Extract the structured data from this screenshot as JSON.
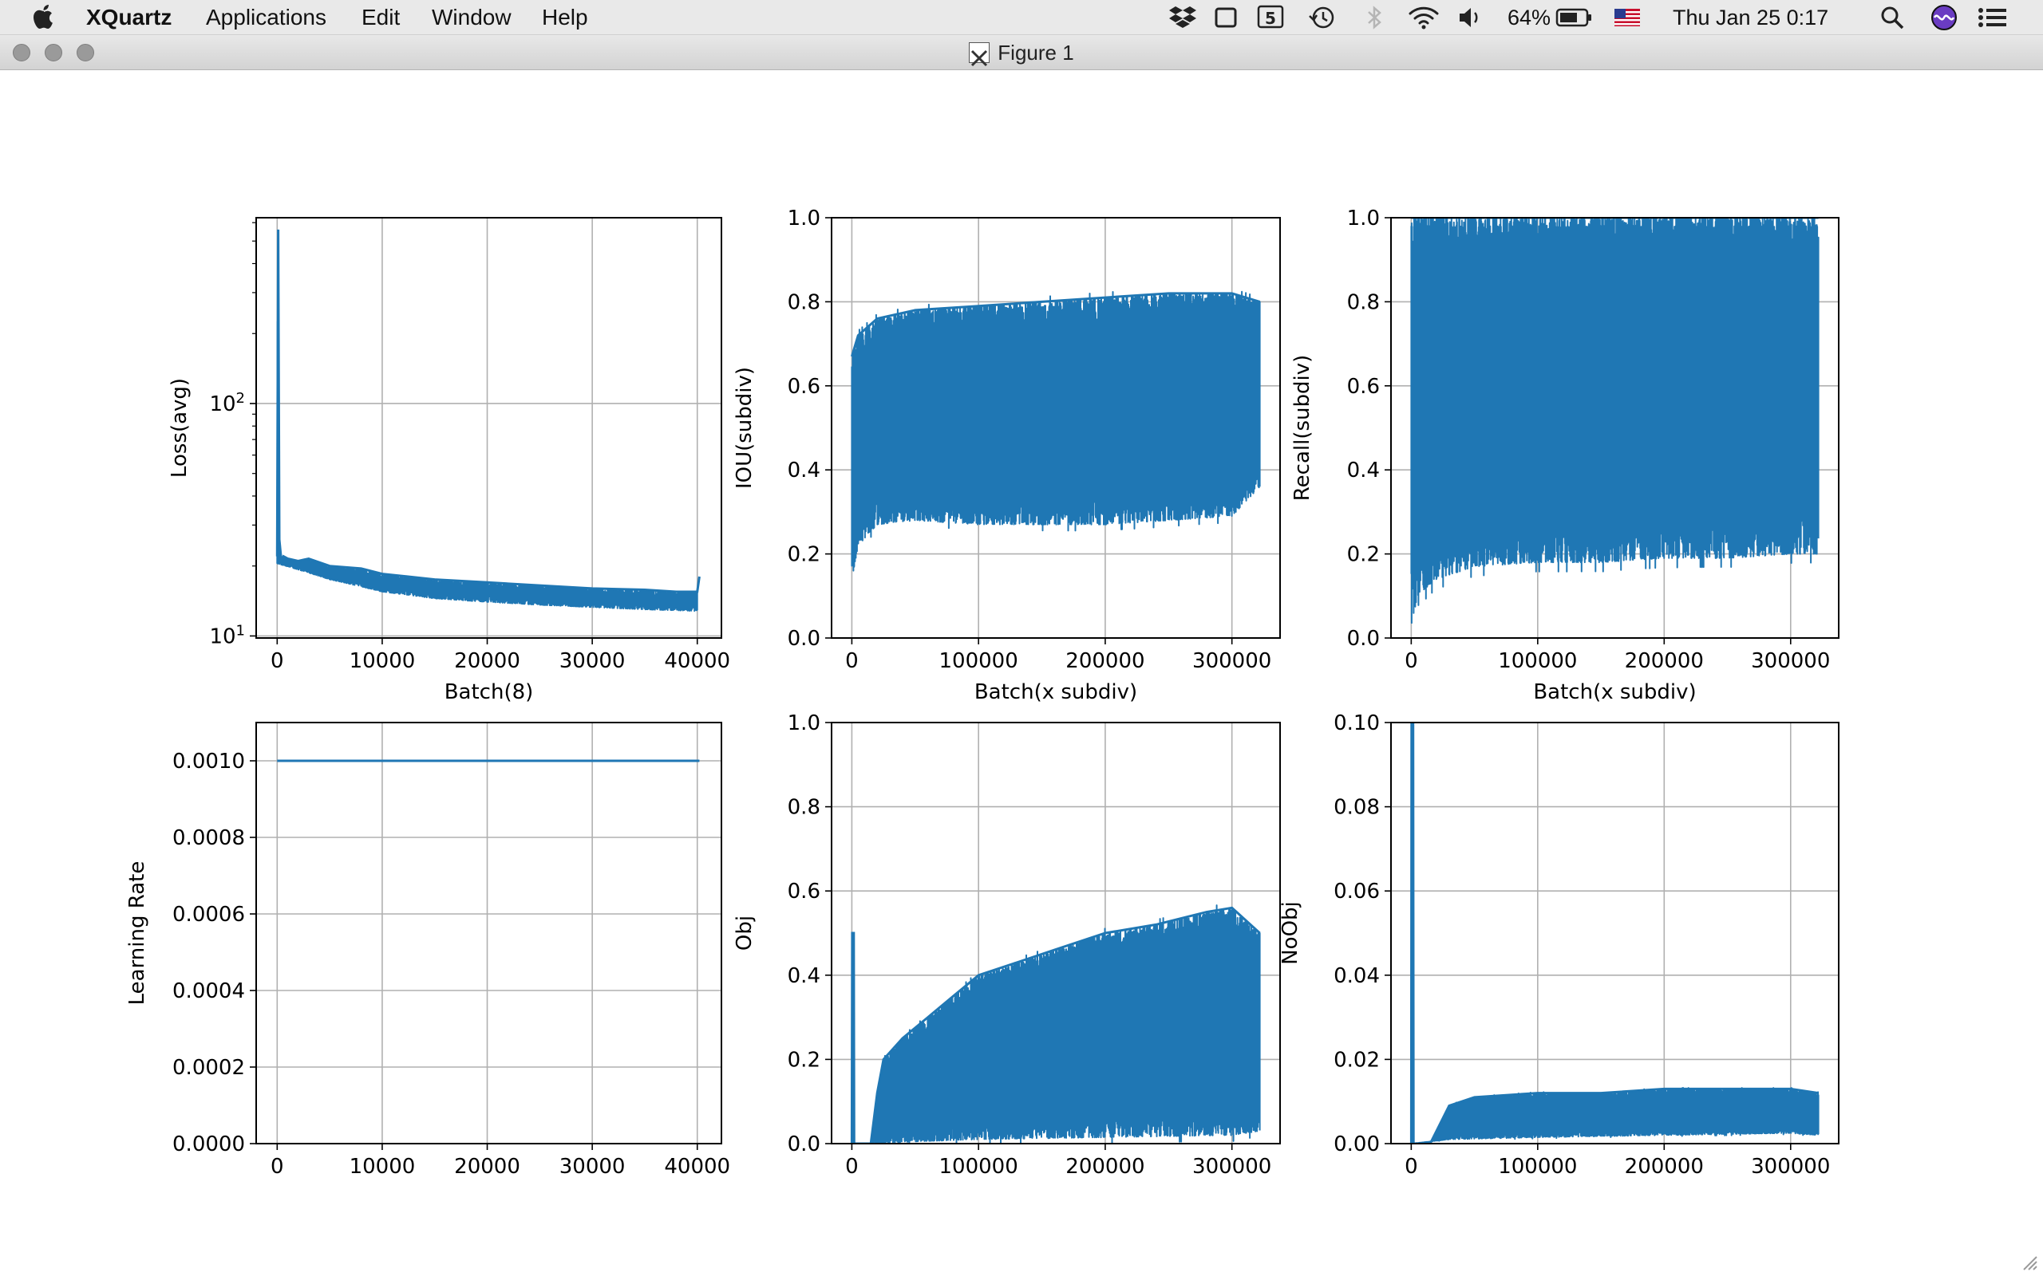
{
  "menubar": {
    "app_name": "XQuartz",
    "items": [
      "Applications",
      "Edit",
      "Window",
      "Help"
    ],
    "battery": "64%",
    "datetime": "Thu Jan 25  0:17",
    "icons": [
      "dropbox-icon",
      "screen-icon",
      "html5-icon",
      "time-machine-icon",
      "bluetooth-icon",
      "wifi-icon",
      "volume-icon",
      "battery-icon",
      "flag-icon",
      "search-icon",
      "siri-icon",
      "notification-list-icon"
    ]
  },
  "window": {
    "title": "Figure 1"
  },
  "colors": {
    "series": "#1f77b4",
    "grid": "#b0b0b0"
  },
  "chart_data": [
    {
      "type": "line",
      "xlabel": "Batch(8)",
      "ylabel": "Loss(avg)",
      "yscale": "log",
      "xlim": [
        -2000,
        42300
      ],
      "ylim": [
        9.8,
        630
      ],
      "xticks": [
        0,
        10000,
        20000,
        30000,
        40000
      ],
      "xtick_labels": [
        "0",
        "10000",
        "20000",
        "30000",
        "40000"
      ],
      "yticks": [
        10,
        100
      ],
      "ytick_labels": [
        [
          "10",
          "1"
        ],
        [
          "10",
          "2"
        ]
      ],
      "grid": true,
      "series": [
        {
          "x": [
            0,
            100,
            200,
            400,
            600,
            1000,
            2000,
            3000,
            5000,
            8000,
            10000,
            15000,
            20000,
            25000,
            30000,
            35000,
            38000,
            40000,
            40200
          ],
          "y": [
            22,
            560,
            26,
            21,
            22,
            21.5,
            21,
            21.5,
            20,
            19.5,
            18.5,
            17.5,
            17,
            16.5,
            16,
            15.8,
            15.5,
            15.5,
            18
          ]
        },
        {
          "x": [
            0,
            5000,
            10000,
            15000,
            20000,
            25000,
            30000,
            35000,
            40000
          ],
          "y": [
            20.5,
            17.5,
            15.5,
            14.5,
            14,
            13.6,
            13.3,
            13,
            12.8
          ]
        }
      ]
    },
    {
      "type": "line",
      "xlabel": "Batch(x subdiv)",
      "ylabel": "IOU(subdiv)",
      "xlim": [
        -16000,
        338000
      ],
      "ylim": [
        0,
        1
      ],
      "xticks": [
        0,
        100000,
        200000,
        300000
      ],
      "xtick_labels": [
        "0",
        "100000",
        "200000",
        "300000"
      ],
      "yticks": [
        0,
        0.2,
        0.4,
        0.6,
        0.8,
        1.0
      ],
      "ytick_labels": [
        "0.0",
        "0.2",
        "0.4",
        "0.6",
        "0.8",
        "1.0"
      ],
      "grid": true,
      "series": [
        {
          "x": [
            0,
            5000,
            20000,
            50000,
            100000,
            150000,
            200000,
            250000,
            300000,
            322000
          ],
          "y": [
            0.67,
            0.72,
            0.76,
            0.78,
            0.79,
            0.8,
            0.81,
            0.82,
            0.82,
            0.8
          ]
        },
        {
          "x": [
            0,
            5000,
            20000,
            50000,
            100000,
            150000,
            200000,
            250000,
            300000,
            322000
          ],
          "y": [
            0.14,
            0.22,
            0.27,
            0.28,
            0.27,
            0.27,
            0.27,
            0.28,
            0.29,
            0.36
          ]
        }
      ]
    },
    {
      "type": "line",
      "xlabel": "Batch(x subdiv)",
      "ylabel": "Recall(subdiv)",
      "xlim": [
        -16000,
        338000
      ],
      "ylim": [
        0,
        1
      ],
      "xticks": [
        0,
        100000,
        200000,
        300000
      ],
      "xtick_labels": [
        "0",
        "100000",
        "200000",
        "300000"
      ],
      "yticks": [
        0,
        0.2,
        0.4,
        0.6,
        0.8,
        1.0
      ],
      "ytick_labels": [
        "0.0",
        "0.2",
        "0.4",
        "0.6",
        "0.8",
        "1.0"
      ],
      "grid": true,
      "series": [
        {
          "x": [
            0,
            322000
          ],
          "y": [
            1.0,
            1.0
          ]
        },
        {
          "x": [
            0,
            5000,
            20000,
            50000,
            100000,
            150000,
            200000,
            250000,
            300000,
            322000
          ],
          "y": [
            0.03,
            0.1,
            0.14,
            0.17,
            0.18,
            0.18,
            0.19,
            0.19,
            0.2,
            0.2
          ]
        }
      ]
    },
    {
      "type": "line",
      "xlabel": "",
      "ylabel": "Learning Rate",
      "xlim": [
        -2000,
        42300
      ],
      "ylim": [
        0,
        0.0011
      ],
      "xticks": [
        0,
        10000,
        20000,
        30000,
        40000
      ],
      "xtick_labels": [
        "0",
        "10000",
        "20000",
        "30000",
        "40000"
      ],
      "yticks": [
        0,
        0.0002,
        0.0004,
        0.0006,
        0.0008,
        0.001
      ],
      "ytick_labels": [
        "0.0000",
        "0.0002",
        "0.0004",
        "0.0006",
        "0.0008",
        "0.0010"
      ],
      "grid": true,
      "series": [
        {
          "x": [
            0,
            40200
          ],
          "y": [
            0.001,
            0.001
          ]
        }
      ]
    },
    {
      "type": "line",
      "xlabel": "",
      "ylabel": "Obj",
      "xlim": [
        -16000,
        338000
      ],
      "ylim": [
        0,
        1
      ],
      "xticks": [
        0,
        100000,
        200000,
        300000
      ],
      "xtick_labels": [
        "0",
        "100000",
        "200000",
        "300000"
      ],
      "yticks": [
        0,
        0.2,
        0.4,
        0.6,
        0.8,
        1.0
      ],
      "ytick_labels": [
        "0.0",
        "0.2",
        "0.4",
        "0.6",
        "0.8",
        "1.0"
      ],
      "grid": true,
      "series": [
        {
          "x": [
            0,
            300,
            1500,
            1800,
            15000,
            20000,
            25000,
            40000,
            60000,
            80000,
            100000,
            130000,
            160000,
            200000,
            240000,
            280000,
            300000,
            322000
          ],
          "y": [
            0,
            0.5,
            0.5,
            0,
            0,
            0.12,
            0.2,
            0.25,
            0.3,
            0.35,
            0.4,
            0.43,
            0.46,
            0.5,
            0.52,
            0.55,
            0.56,
            0.5
          ]
        },
        {
          "x": [
            0,
            20000,
            50000,
            100000,
            200000,
            300000,
            322000
          ],
          "y": [
            0,
            0,
            0.005,
            0.01,
            0.015,
            0.02,
            0.03
          ]
        }
      ]
    },
    {
      "type": "line",
      "xlabel": "",
      "ylabel": "NoObj",
      "xlim": [
        -16000,
        338000
      ],
      "ylim": [
        0,
        0.1
      ],
      "xticks": [
        0,
        100000,
        200000,
        300000
      ],
      "xtick_labels": [
        "0",
        "100000",
        "200000",
        "300000"
      ],
      "yticks": [
        0,
        0.02,
        0.04,
        0.06,
        0.08,
        0.1
      ],
      "ytick_labels": [
        "0.00",
        "0.02",
        "0.04",
        "0.06",
        "0.08",
        "0.10"
      ],
      "grid": true,
      "series": [
        {
          "x": [
            0,
            300,
            1500,
            1800,
            15000,
            25000,
            30000,
            50000,
            100000,
            150000,
            200000,
            250000,
            300000,
            322000
          ],
          "y": [
            0,
            0.1,
            0.1,
            0,
            0,
            0.006,
            0.009,
            0.011,
            0.012,
            0.012,
            0.013,
            0.013,
            0.013,
            0.012
          ]
        },
        {
          "x": [
            0,
            30000,
            100000,
            200000,
            300000,
            322000
          ],
          "y": [
            0,
            0.001,
            0.0015,
            0.002,
            0.0025,
            0.002
          ]
        }
      ]
    }
  ]
}
